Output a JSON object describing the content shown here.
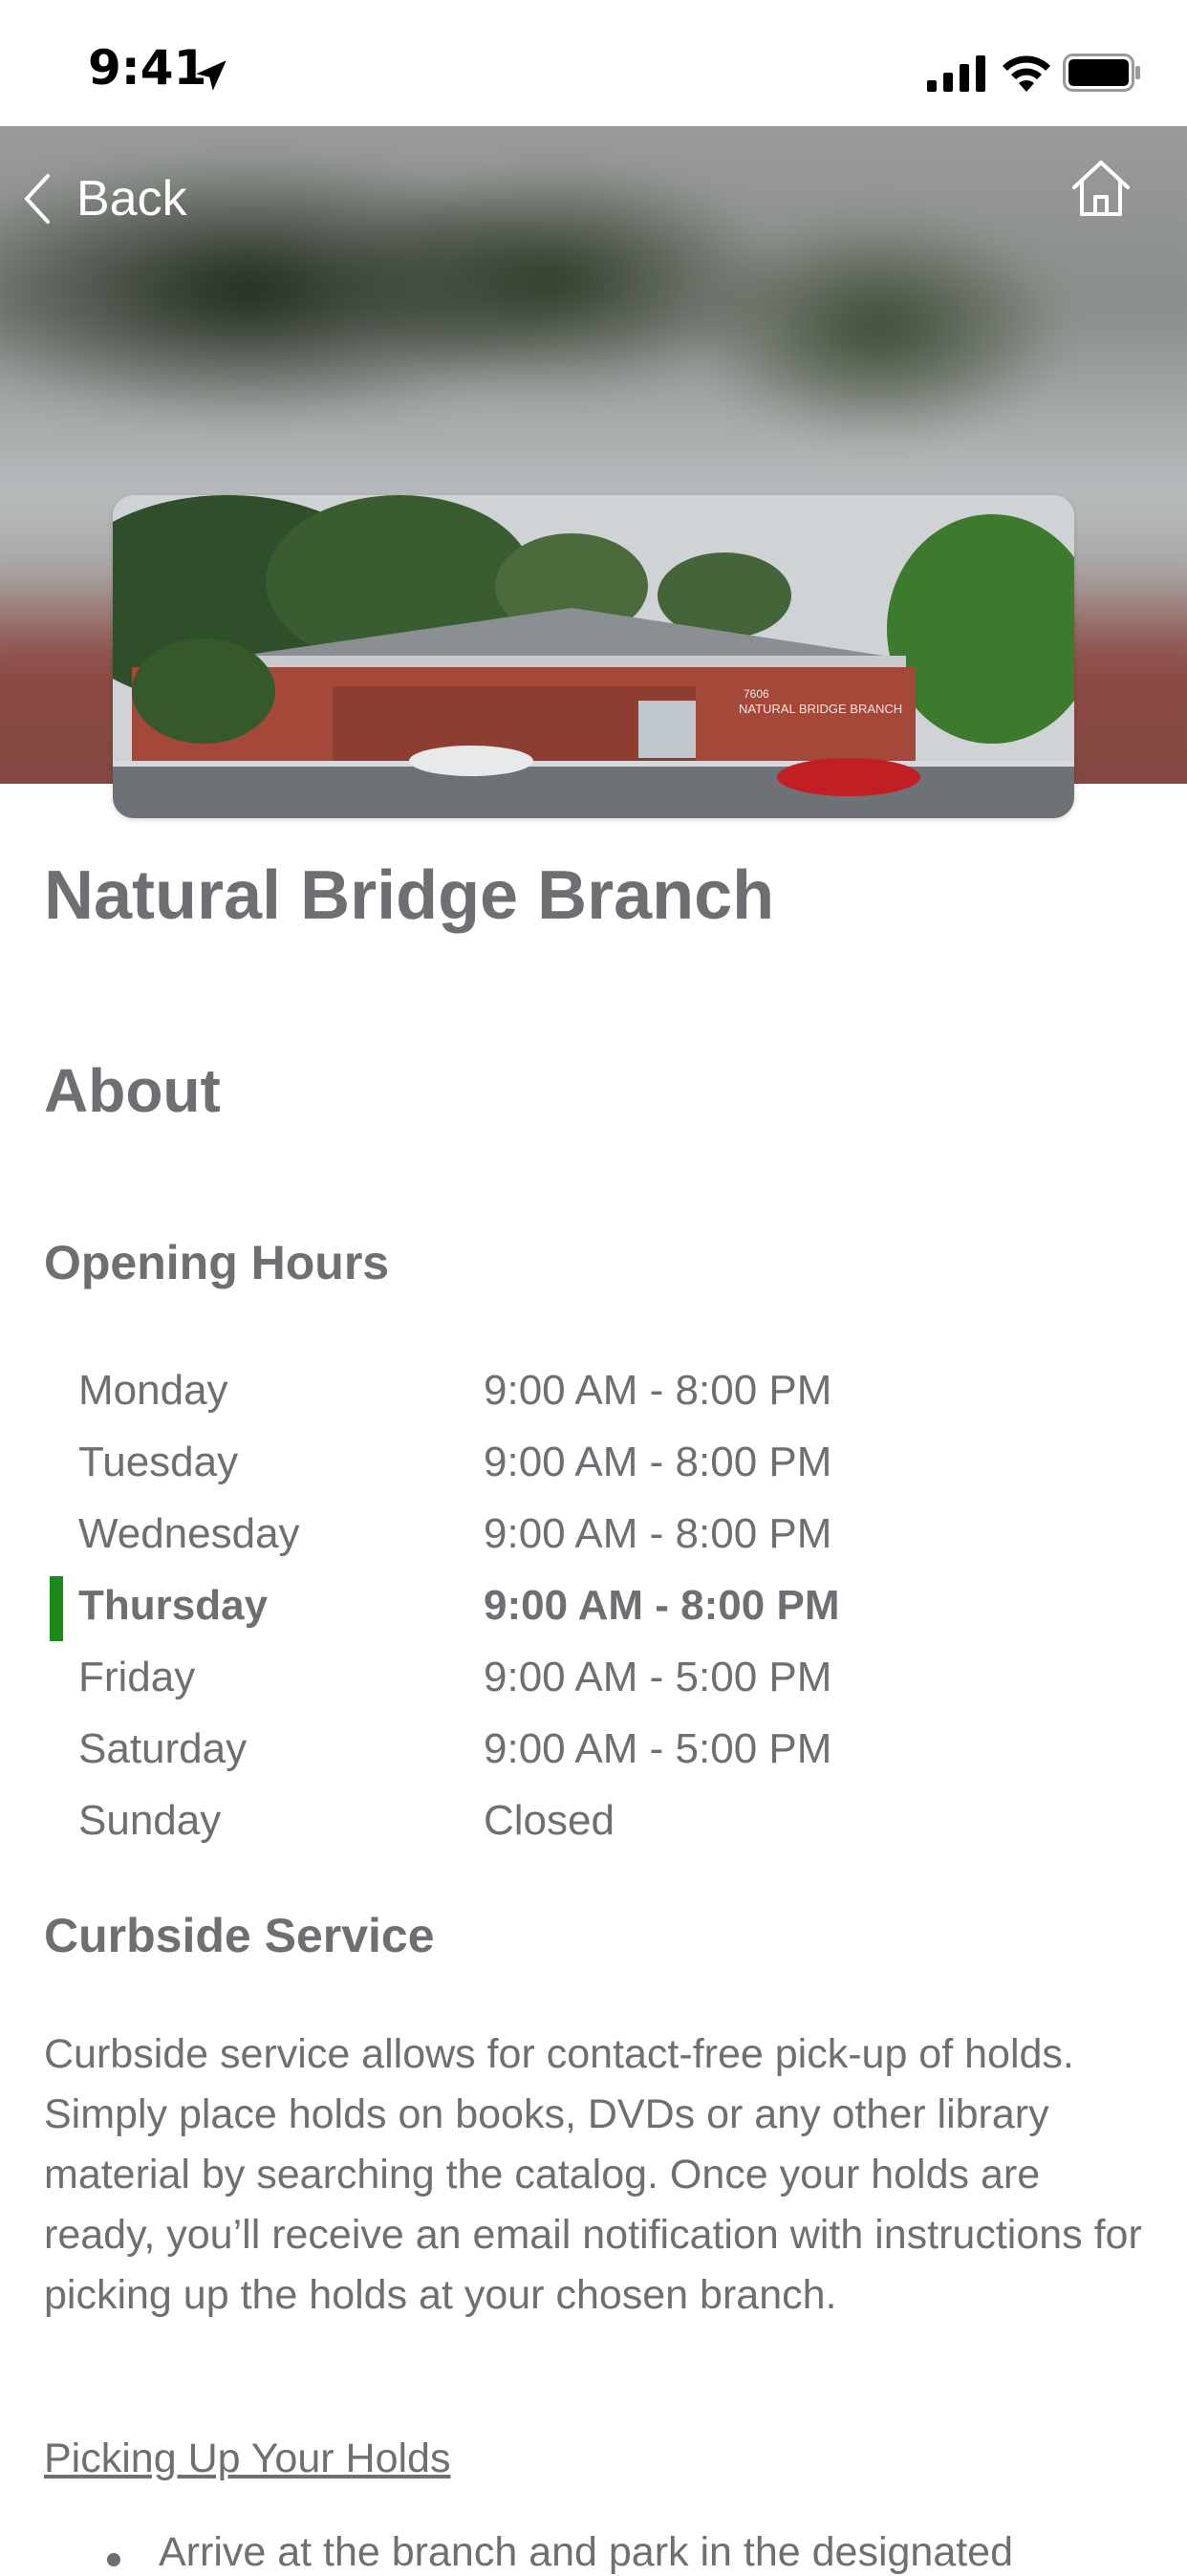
{
  "status_bar": {
    "time": "9:41",
    "icons": [
      "location-arrow-icon",
      "cellular-signal-icon",
      "wifi-icon",
      "battery-icon"
    ]
  },
  "navigation": {
    "back_label": "Back",
    "back_icon": "chevron-left-icon",
    "home_icon": "home-icon"
  },
  "hero": {
    "image_subject": "library branch building photo",
    "building_sign": "NATURAL BRIDGE BRANCH",
    "building_number": "7606"
  },
  "branch": {
    "name": "Natural Bridge Branch"
  },
  "about": {
    "heading": "About",
    "hours_heading": "Opening Hours",
    "today_marker_color": "#1a8a1a",
    "hours": [
      {
        "day": "Monday",
        "time": "9:00 AM - 8:00 PM",
        "today": false
      },
      {
        "day": "Tuesday",
        "time": "9:00 AM - 8:00 PM",
        "today": false
      },
      {
        "day": "Wednesday",
        "time": "9:00 AM - 8:00 PM",
        "today": false
      },
      {
        "day": "Thursday",
        "time": "9:00 AM - 8:00 PM",
        "today": true
      },
      {
        "day": "Friday",
        "time": "9:00 AM - 5:00 PM",
        "today": false
      },
      {
        "day": "Saturday",
        "time": "9:00 AM - 5:00 PM",
        "today": false
      },
      {
        "day": "Sunday",
        "time": "Closed",
        "today": false
      }
    ]
  },
  "curbside": {
    "heading": "Curbside Service",
    "body": "Curbside service allows for contact-free pick-up of holds. Simply place holds on books, DVDs or any other library material by searching the catalog. Once your holds are ready, you’ll receive an email notification with instructions for picking up the holds at your chosen branch.",
    "link_label": "Picking Up Your Holds",
    "bullets": [
      "Arrive at the branch and park in the designated"
    ]
  },
  "colors": {
    "text": "#6e6e73",
    "accent_today": "#1a8a1a"
  }
}
